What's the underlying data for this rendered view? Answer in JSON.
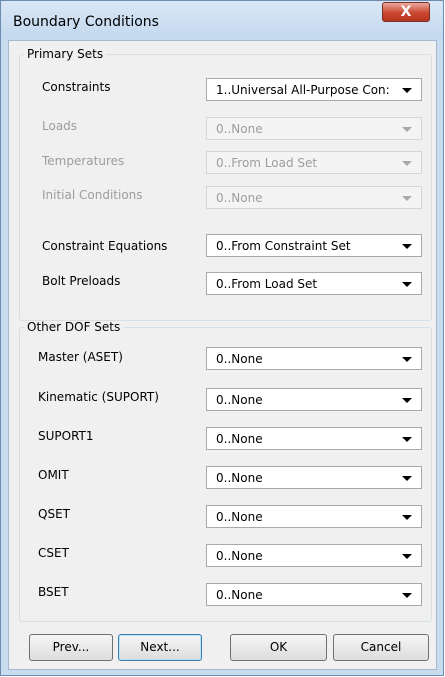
{
  "window": {
    "title": "Boundary Conditions",
    "close_glyph": "X"
  },
  "primary_sets": {
    "legend": "Primary Sets",
    "rows": [
      {
        "label": "Constraints",
        "value": "1..Universal All-Purpose Con:",
        "enabled": true
      },
      {
        "label": "Loads",
        "value": "0..None",
        "enabled": false
      },
      {
        "label": "Temperatures",
        "value": "0..From Load Set",
        "enabled": false
      },
      {
        "label": "Initial Conditions",
        "value": "0..None",
        "enabled": false
      },
      {
        "label": "Constraint Equations",
        "value": "0..From Constraint Set",
        "enabled": true
      },
      {
        "label": "Bolt Preloads",
        "value": "0..From Load Set",
        "enabled": true
      }
    ]
  },
  "other_dof_sets": {
    "legend": "Other DOF Sets",
    "rows": [
      {
        "label": "Master (ASET)",
        "value": "0..None"
      },
      {
        "label": "Kinematic (SUPORT)",
        "value": "0..None"
      },
      {
        "label": "SUPORT1",
        "value": "0..None"
      },
      {
        "label": "OMIT",
        "value": "0..None"
      },
      {
        "label": "QSET",
        "value": "0..None"
      },
      {
        "label": "CSET",
        "value": "0..None"
      },
      {
        "label": "BSET",
        "value": "0..None"
      }
    ]
  },
  "buttons": {
    "prev": "Prev...",
    "next": "Next...",
    "ok": "OK",
    "cancel": "Cancel"
  },
  "icons": {
    "close": "close-icon",
    "dropdown": "chevron-down-icon"
  },
  "colors": {
    "window_frame": "#c8dbef",
    "close_button": "#c9462f",
    "disabled_text": "#9d9d9d"
  }
}
